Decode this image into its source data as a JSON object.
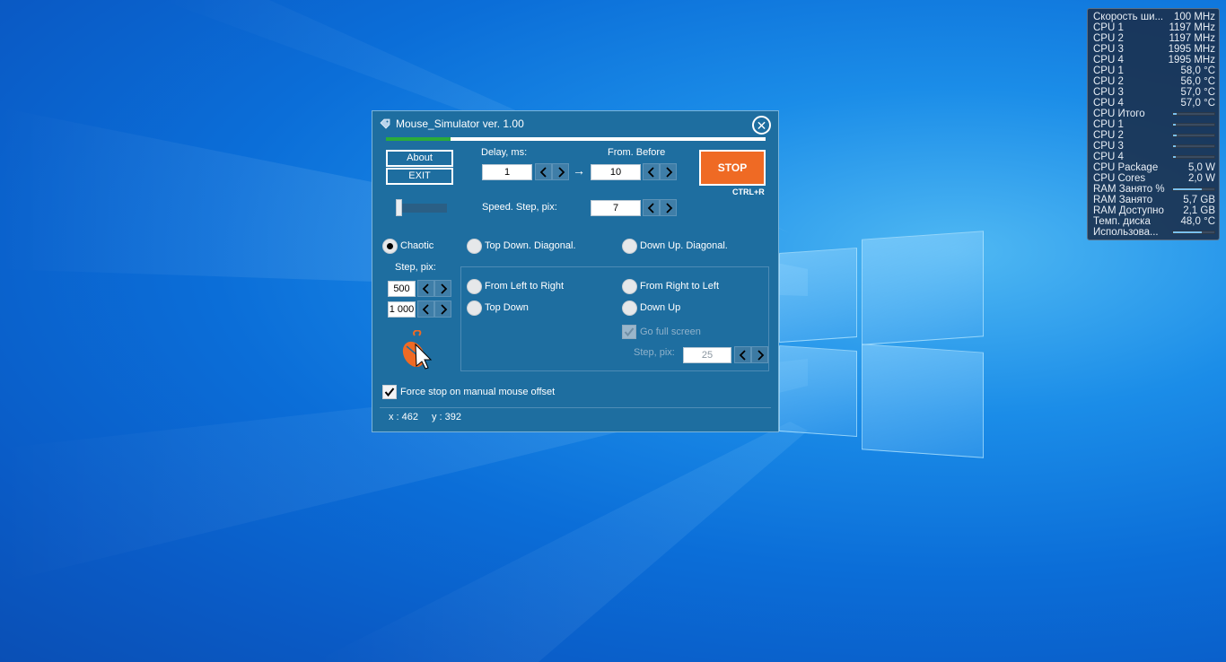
{
  "app": {
    "title": "Mouse_Simulator ver. 1.00",
    "progress_percent": 17,
    "about_label": "About",
    "exit_label": "EXIT",
    "delay_label": "Delay, ms:",
    "from_before_label": "From. Before",
    "delay_from": "1",
    "arrow": "→",
    "delay_to": "10",
    "stop_label": "STOP",
    "stop_shortcut": "CTRL+R",
    "speed_label": "Speed. Step, pix:",
    "speed_value": "7",
    "slider_percent": 0,
    "modes": {
      "chaotic": "Chaotic",
      "top_down_diag": "Top Down. Diagonal.",
      "down_up_diag": "Down Up. Diagonal.",
      "left_right": "From Left to Right",
      "right_left": "From Right to Left",
      "top_down": "Top Down",
      "down_up": "Down Up"
    },
    "selected_mode": "Chaotic",
    "step_label": "Step, pix:",
    "step_min": "500",
    "step_max": "1 000",
    "go_full_screen_label": "Go full screen",
    "go_full_step_label": "Step, pix:",
    "go_full_step_value": "25",
    "force_stop_label": "Force stop on manual mouse offset",
    "force_stop_checked": true,
    "coord_x": "x : 462",
    "coord_y": "y : 392",
    "colors": {
      "window": "#1e6ea0",
      "stop": "#ef6a24",
      "progress": "#2bab3a"
    }
  },
  "gadget": {
    "rows": [
      {
        "label": "Скорость ши...",
        "value": "100 MHz"
      },
      {
        "label": "CPU 1",
        "value": "1197 MHz"
      },
      {
        "label": "CPU 2",
        "value": "1197 MHz"
      },
      {
        "label": "CPU 3",
        "value": "1995 MHz"
      },
      {
        "label": "CPU 4",
        "value": "1995 MHz"
      },
      {
        "label": "CPU 1",
        "value": "58,0 °C"
      },
      {
        "label": "CPU 2",
        "value": "56,0 °C"
      },
      {
        "label": "CPU 3",
        "value": "57,0 °C"
      },
      {
        "label": "CPU 4",
        "value": "57,0 °C"
      },
      {
        "label": "CPU Итого",
        "bar": 0.08
      },
      {
        "label": "CPU 1",
        "bar": 0.06
      },
      {
        "label": "CPU 2",
        "bar": 0.08
      },
      {
        "label": "CPU 3",
        "bar": 0.06
      },
      {
        "label": "CPU 4",
        "bar": 0.06
      },
      {
        "label": "CPU Package",
        "value": "5,0 W"
      },
      {
        "label": "CPU Cores",
        "value": "2,0 W"
      },
      {
        "label": "RAM Занято %",
        "bar": 0.7
      },
      {
        "label": "RAM Занято",
        "value": "5,7 GB"
      },
      {
        "label": "RAM Доступно",
        "value": "2,1 GB"
      },
      {
        "label": "Темп. диска",
        "value": "48,0 °C"
      },
      {
        "label": "Использова...",
        "bar": 0.7
      }
    ]
  }
}
